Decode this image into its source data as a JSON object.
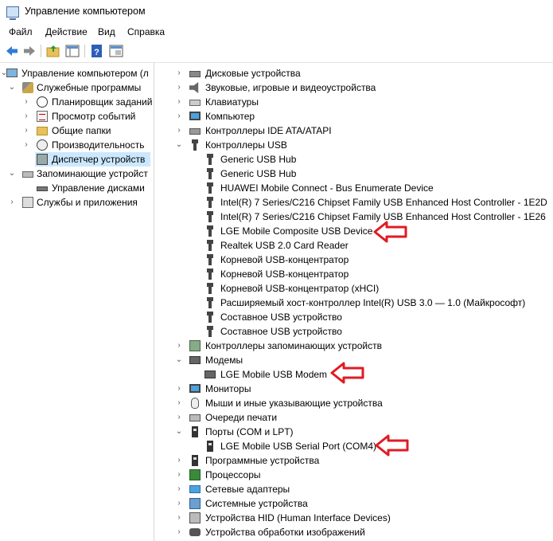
{
  "window": {
    "title": "Управление компьютером"
  },
  "menu": [
    "Файл",
    "Действие",
    "Вид",
    "Справка"
  ],
  "toolbar": {
    "buttons": [
      "back-icon",
      "forward-icon",
      "up-folder-icon",
      "show-hide-tree-icon",
      "help-icon",
      "properties-icon"
    ]
  },
  "left_tree": [
    {
      "label": "Управление компьютером (л",
      "icon": "computer-management-icon"
    },
    {
      "label": "Служебные программы",
      "icon": "system-tools-icon"
    },
    {
      "label": "Планировщик заданий",
      "icon": "task-scheduler-icon"
    },
    {
      "label": "Просмотр событий",
      "icon": "event-viewer-icon"
    },
    {
      "label": "Общие папки",
      "icon": "shared-folders-icon"
    },
    {
      "label": "Производительность",
      "icon": "performance-icon"
    },
    {
      "label": "Диспетчер устройств",
      "icon": "device-manager-icon"
    },
    {
      "label": "Запоминающие устройст",
      "icon": "storage-icon"
    },
    {
      "label": "Управление дисками",
      "icon": "disk-management-icon"
    },
    {
      "label": "Службы и приложения",
      "icon": "services-icon"
    }
  ],
  "right_tree": [
    {
      "label": "Дисковые устройства",
      "icon": "disk-drive-icon"
    },
    {
      "label": "Звуковые, игровые и видеоустройства",
      "icon": "sound-icon"
    },
    {
      "label": "Клавиатуры",
      "icon": "keyboard-icon"
    },
    {
      "label": "Компьютер",
      "icon": "computer-icon"
    },
    {
      "label": "Контроллеры IDE ATA/ATAPI",
      "icon": "ide-controller-icon"
    },
    {
      "label": "Контроллеры USB",
      "icon": "usb-icon"
    },
    {
      "label": "Generic USB Hub",
      "icon": "usb-icon"
    },
    {
      "label": "Generic USB Hub",
      "icon": "usb-icon"
    },
    {
      "label": "HUAWEI Mobile Connect - Bus Enumerate Device",
      "icon": "usb-icon"
    },
    {
      "label": "Intel(R) 7 Series/C216 Chipset Family USB Enhanced Host Controller - 1E2D",
      "icon": "usb-icon"
    },
    {
      "label": "Intel(R) 7 Series/C216 Chipset Family USB Enhanced Host Controller - 1E26",
      "icon": "usb-icon"
    },
    {
      "label": "LGE Mobile Composite USB Device",
      "icon": "usb-icon"
    },
    {
      "label": "Realtek USB 2.0 Card Reader",
      "icon": "usb-icon"
    },
    {
      "label": "Корневой USB-концентратор",
      "icon": "usb-icon"
    },
    {
      "label": "Корневой USB-концентратор",
      "icon": "usb-icon"
    },
    {
      "label": "Корневой USB-концентратор (xHCI)",
      "icon": "usb-icon"
    },
    {
      "label": "Расширяемый хост-контроллер Intel(R) USB 3.0 — 1.0 (Майкрософт)",
      "icon": "usb-icon"
    },
    {
      "label": "Составное USB устройство",
      "icon": "usb-icon"
    },
    {
      "label": "Составное USB устройство",
      "icon": "usb-icon"
    },
    {
      "label": "Контроллеры запоминающих устройств",
      "icon": "storage-controller-icon"
    },
    {
      "label": "Модемы",
      "icon": "modem-icon"
    },
    {
      "label": "LGE Mobile USB Modem",
      "icon": "modem-icon"
    },
    {
      "label": "Мониторы",
      "icon": "monitor-icon"
    },
    {
      "label": "Мыши и иные указывающие устройства",
      "icon": "mouse-icon"
    },
    {
      "label": "Очереди печати",
      "icon": "printer-icon"
    },
    {
      "label": "Порты (COM и LPT)",
      "icon": "port-icon"
    },
    {
      "label": "LGE Mobile USB Serial Port (COM4)",
      "icon": "port-icon"
    },
    {
      "label": "Программные устройства",
      "icon": "software-device-icon"
    },
    {
      "label": "Процессоры",
      "icon": "processor-icon"
    },
    {
      "label": "Сетевые адаптеры",
      "icon": "network-adapter-icon"
    },
    {
      "label": "Системные устройства",
      "icon": "system-device-icon"
    },
    {
      "label": "Устройства HID (Human Interface Devices)",
      "icon": "hid-icon"
    },
    {
      "label": "Устройства обработки изображений",
      "icon": "imaging-device-icon"
    }
  ],
  "colors": {
    "selection": "#cce8ff",
    "arrow": "#e01b24"
  }
}
